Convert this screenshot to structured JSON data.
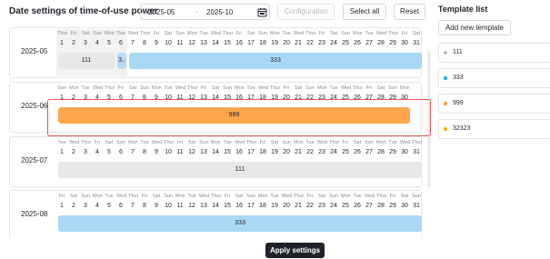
{
  "header": {
    "title": "Date settings of time-of-use power",
    "range_start": "2025-05",
    "range_sep": "-",
    "range_end": "2025-10",
    "configuration_label": "Configuration",
    "select_all_label": "Select all",
    "reset_label": "Reset"
  },
  "months": [
    {
      "label": "2025-05",
      "dows": [
        "Thur",
        "Fri",
        "Sat",
        "Sun",
        "Mon",
        "Tue",
        "Wed",
        "Thur",
        "Fri",
        "Sat",
        "Sun",
        "Mon",
        "Tue",
        "Wed",
        "Thur",
        "Fri",
        "Sat",
        "Sun",
        "Mon",
        "Tue",
        "Wed",
        "Thur",
        "Fri",
        "Sat",
        "Sun",
        "Mon",
        "Tue",
        "Wed",
        "Thur",
        "Fri",
        "Sat"
      ],
      "selected_days": [
        1,
        2,
        3,
        4,
        5,
        6
      ],
      "bars": [
        {
          "label": "111",
          "start": 1,
          "end": 5,
          "color": "#e8e8e8"
        },
        {
          "label": "3..",
          "start": 6,
          "end": 6,
          "color": "#b9dcf2"
        },
        {
          "label": "333",
          "start": 7,
          "end": 31,
          "color": "#a8d8f5"
        }
      ]
    },
    {
      "label": "2025-06",
      "dows": [
        "Sun",
        "Mon",
        "Tue",
        "Wed",
        "Thur",
        "Fri",
        "Sat",
        "Sun",
        "Mon",
        "Tue",
        "Wed",
        "Thur",
        "Fri",
        "Sat",
        "Sun",
        "Mon",
        "Tue",
        "Wed",
        "Thur",
        "Fri",
        "Sat",
        "Sun",
        "Mon",
        "Tue",
        "Wed",
        "Thur",
        "Fri",
        "Sat",
        "Sun",
        "Mon"
      ],
      "selected_days": [],
      "bars": [
        {
          "label": "999",
          "start": 1,
          "end": 30,
          "color": "#ffa64d"
        }
      ]
    },
    {
      "label": "2025-07",
      "dows": [
        "Tue",
        "Wed",
        "Thur",
        "Fri",
        "Sat",
        "Sun",
        "Mon",
        "Tue",
        "Wed",
        "Thur",
        "Fri",
        "Sat",
        "Sun",
        "Mon",
        "Tue",
        "Wed",
        "Thur",
        "Fri",
        "Sat",
        "Sun",
        "Mon",
        "Tue",
        "Wed",
        "Thur",
        "Fri",
        "Sat",
        "Sun",
        "Mon",
        "Tue",
        "Wed",
        "Thur"
      ],
      "selected_days": [],
      "bars": [
        {
          "label": "111",
          "start": 1,
          "end": 31,
          "color": "#e8e8e8"
        }
      ]
    },
    {
      "label": "2025-08",
      "dows": [
        "Fri",
        "Sat",
        "Sun",
        "Mon",
        "Tue",
        "Wed",
        "Thur",
        "Fri",
        "Sat",
        "Sun",
        "Mon",
        "Tue",
        "Wed",
        "Thur",
        "Fri",
        "Sat",
        "Sun",
        "Mon",
        "Tue",
        "Wed",
        "Thur",
        "Fri",
        "Sat",
        "Sun",
        "Mon",
        "Tue",
        "Wed",
        "Thur",
        "Fri",
        "Sat",
        "Sun"
      ],
      "selected_days": [],
      "bars": [
        {
          "label": "333",
          "start": 1,
          "end": 31,
          "color": "#a8d8f5"
        }
      ]
    }
  ],
  "apply_label": "Apply settings",
  "templates": {
    "title": "Template list",
    "add_label": "Add new template",
    "items": [
      {
        "label": "111",
        "color": "#bfbfbf"
      },
      {
        "label": "333",
        "color": "#1aa3e8"
      },
      {
        "label": "999",
        "color": "#ff9933"
      },
      {
        "label": "32323",
        "color": "#f2b600"
      }
    ]
  }
}
